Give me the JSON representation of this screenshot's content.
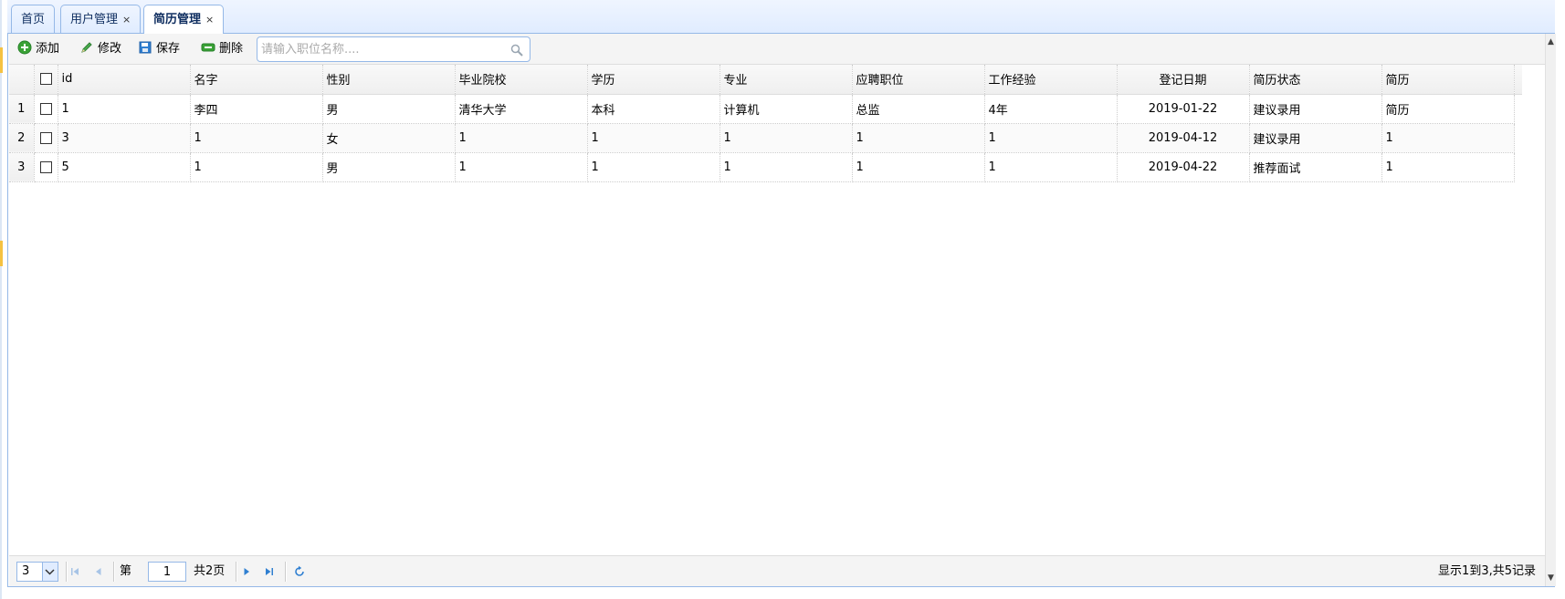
{
  "tabs": [
    {
      "label": "首页",
      "closable": false,
      "active": false
    },
    {
      "label": "用户管理",
      "closable": true,
      "active": false
    },
    {
      "label": "简历管理",
      "closable": true,
      "active": true
    }
  ],
  "tab_close_glyph": "×",
  "toolbar": {
    "add_label": "添加",
    "edit_label": "修改",
    "save_label": "保存",
    "delete_label": "删除",
    "search_placeholder": "请输入职位名称...."
  },
  "grid": {
    "columns": [
      "id",
      "名字",
      "性别",
      "毕业院校",
      "学历",
      "专业",
      "应聘职位",
      "工作经验",
      "登记日期",
      "简历状态",
      "简历"
    ],
    "rows": [
      {
        "row_number": "1",
        "cells": [
          "1",
          "李四",
          "男",
          "清华大学",
          "本科",
          "计算机",
          "总监",
          "4年",
          "2019-01-22",
          "建议录用",
          "简历"
        ]
      },
      {
        "row_number": "2",
        "cells": [
          "3",
          "1",
          "女",
          "1",
          "1",
          "1",
          "1",
          "1",
          "2019-04-12",
          "建议录用",
          "1"
        ]
      },
      {
        "row_number": "3",
        "cells": [
          "5",
          "1",
          "男",
          "1",
          "1",
          "1",
          "1",
          "1",
          "2019-04-22",
          "推荐面试",
          "1"
        ]
      }
    ]
  },
  "pager": {
    "page_size": "3",
    "page_prefix": "第",
    "current_page": "1",
    "page_total_text": "共2页",
    "summary": "显示1到3,共5记录"
  },
  "colors": {
    "border": "#95b8e7",
    "tab_bg": "#e0ecff",
    "icon_blue": "#2f7fd1",
    "add_green": "#3aa236"
  },
  "icons": {
    "add": "plus-circle-icon",
    "edit": "pencil-icon",
    "save": "floppy-disk-icon",
    "delete": "minus-icon",
    "search": "magnifier-icon",
    "first": "first-page-icon",
    "prev": "prev-page-icon",
    "next": "next-page-icon",
    "last": "last-page-icon",
    "refresh": "refresh-icon"
  }
}
